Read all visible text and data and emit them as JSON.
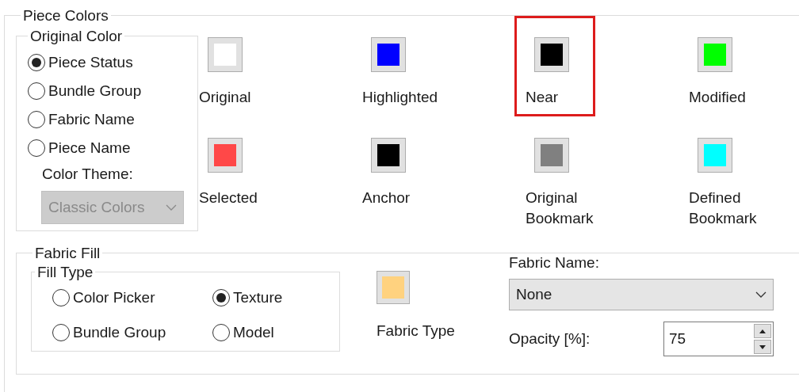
{
  "piece_colors": {
    "title": "Piece Colors",
    "original_color": {
      "title": "Original Color",
      "options": [
        {
          "label": "Piece Status",
          "selected": true
        },
        {
          "label": "Bundle Group",
          "selected": false
        },
        {
          "label": "Fabric Name",
          "selected": false
        },
        {
          "label": "Piece Name",
          "selected": false
        }
      ],
      "color_theme": {
        "label": "Color Theme:",
        "value": "Classic Colors",
        "disabled": true
      }
    },
    "swatches": [
      {
        "label": "Original",
        "color": "#ffffff",
        "highlighted": false
      },
      {
        "label": "Highlighted",
        "color": "#0000ff",
        "highlighted": false
      },
      {
        "label": "Near",
        "color": "#000000",
        "highlighted": true
      },
      {
        "label": "Modified",
        "color": "#00ff00",
        "highlighted": false
      },
      {
        "label": "Selected",
        "color": "#ff4848",
        "highlighted": false
      },
      {
        "label": "Anchor",
        "color": "#000000",
        "highlighted": false
      },
      {
        "label": "Original Bookmark",
        "color": "#808080",
        "highlighted": false
      },
      {
        "label": "Defined Bookmark",
        "color": "#00ffff",
        "highlighted": false
      }
    ],
    "fabric_fill": {
      "title": "Fabric Fill",
      "fill_type": {
        "title": "Fill Type",
        "options": [
          {
            "label": "Color Picker",
            "selected": false
          },
          {
            "label": "Texture",
            "selected": true
          },
          {
            "label": "Bundle Group",
            "selected": false
          },
          {
            "label": "Model",
            "selected": false
          }
        ]
      },
      "fabric_type": {
        "label": "Fabric Type",
        "color": "#ffd27f"
      },
      "fabric_name": {
        "label": "Fabric Name:",
        "value": "None"
      },
      "opacity": {
        "label": "Opacity [%]:",
        "value": "75"
      }
    }
  }
}
